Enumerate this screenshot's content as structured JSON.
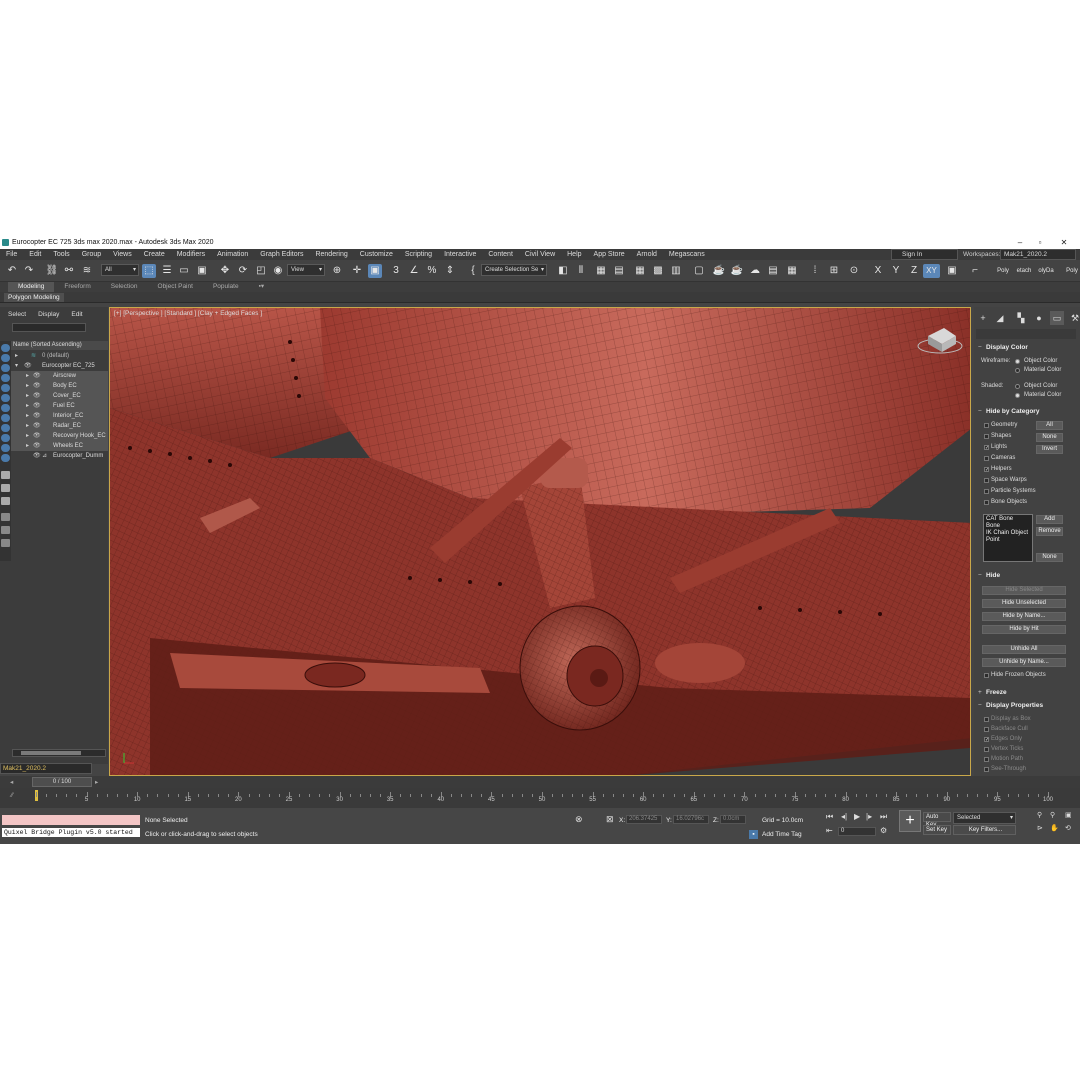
{
  "window": {
    "title": "Eurocopter EC 725 3ds max 2020.max - Autodesk 3ds Max 2020"
  },
  "menu": [
    "File",
    "Edit",
    "Tools",
    "Group",
    "Views",
    "Create",
    "Modifiers",
    "Animation",
    "Graph Editors",
    "Rendering",
    "Customize",
    "Scripting",
    "Interactive",
    "Content",
    "Civil View",
    "Help",
    "App Store",
    "Arnold",
    "Megascans"
  ],
  "signin": "Sign In",
  "workspaces": {
    "label": "Workspaces:",
    "value": "Mak21_2020.2"
  },
  "toolbar": {
    "filter": "All",
    "refcoord": "View",
    "selection_set": "Create Selection Se",
    "axis_x": "X",
    "axis_y": "Y",
    "axis_z": "Z",
    "axis_xy": "XY",
    "right_tabs": [
      "Poly",
      "etach",
      "olyDa",
      "Poly"
    ]
  },
  "ribbon": {
    "tabs": [
      "Modeling",
      "Freeform",
      "Selection",
      "Object Paint",
      "Populate"
    ],
    "active": "Modeling",
    "sub": "Polygon Modeling"
  },
  "explorer": {
    "menu": [
      "Select",
      "Display",
      "Edit"
    ],
    "header": "Name (Sorted Ascending)",
    "rows": [
      {
        "label": "0 (default)"
      },
      {
        "label": "Eurocopter EC_725"
      },
      {
        "label": "Airscrew"
      },
      {
        "label": "Body EC"
      },
      {
        "label": "Cover_EC"
      },
      {
        "label": "Fuel EC"
      },
      {
        "label": "Interior_EC"
      },
      {
        "label": "Radar_EC"
      },
      {
        "label": "Recovery Hook_EC"
      },
      {
        "label": "Wheels EC"
      },
      {
        "label": "Eurocopter_Dumm"
      }
    ],
    "layer": "Mak21_2020.2"
  },
  "viewport": {
    "label": "[+] [Perspective ] [Standard ] [Clay + Edged Faces ]"
  },
  "command_panel": {
    "display_color": {
      "title": "Display Color",
      "wireframe": "Wireframe:",
      "shaded": "Shaded:",
      "object_color": "Object Color",
      "material_color": "Material Color"
    },
    "hide_by_category": {
      "title": "Hide by Category",
      "items": [
        {
          "label": "Geometry",
          "checked": false
        },
        {
          "label": "Shapes",
          "checked": false
        },
        {
          "label": "Lights",
          "checked": true
        },
        {
          "label": "Cameras",
          "checked": false
        },
        {
          "label": "Helpers",
          "checked": true
        },
        {
          "label": "Space Warps",
          "checked": false
        },
        {
          "label": "Particle Systems",
          "checked": false
        },
        {
          "label": "Bone Objects",
          "checked": false
        }
      ],
      "btn_all": "All",
      "btn_none": "None",
      "btn_invert": "Invert",
      "list": [
        "CAT Bone",
        "Bone",
        "IK Chain Object",
        "Point"
      ],
      "btn_add": "Add",
      "btn_remove": "Remove",
      "btn_none2": "None"
    },
    "hide": {
      "title": "Hide",
      "buttons": [
        "Hide Selected",
        "Hide Unselected",
        "Hide by Name...",
        "Hide by Hit",
        "Unhide All",
        "Unhide by Name..."
      ],
      "frozen": "Hide Frozen Objects"
    },
    "freeze": {
      "title": "Freeze"
    },
    "display_properties": {
      "title": "Display Properties",
      "items": [
        "Display as Box",
        "Backface Cull",
        "Edges Only",
        "Vertex Ticks",
        "Motion Path",
        "See-Through"
      ]
    }
  },
  "timeline": {
    "slider": "0 / 100",
    "ticks": [
      "5",
      "10",
      "15",
      "20",
      "25",
      "30",
      "35",
      "40",
      "45",
      "50",
      "55",
      "60",
      "65",
      "70",
      "75",
      "80",
      "85",
      "90",
      "95",
      "100"
    ]
  },
  "status": {
    "quixel": "Quixel Bridge Plugin v5.0 started",
    "selected": "None Selected",
    "prompt": "Click or click-and-drag to select objects",
    "x_label": "X:",
    "x_val": "206.37425",
    "y_label": "Y:",
    "y_val": "16.02796c",
    "z_label": "Z:",
    "z_val": "0.0cm",
    "grid": "Grid = 10.0cm",
    "add_time_tag": "Add Time Tag",
    "frame": "0",
    "auto_key": "Auto Key",
    "set_key": "Set Key",
    "selected_drop": "Selected",
    "key_filters": "Key Filters..."
  },
  "colors": {
    "clay": "#a8443a",
    "viewport_border": "#c9a84a",
    "ui_bg": "#444444",
    "accent": "#5b87b8"
  }
}
